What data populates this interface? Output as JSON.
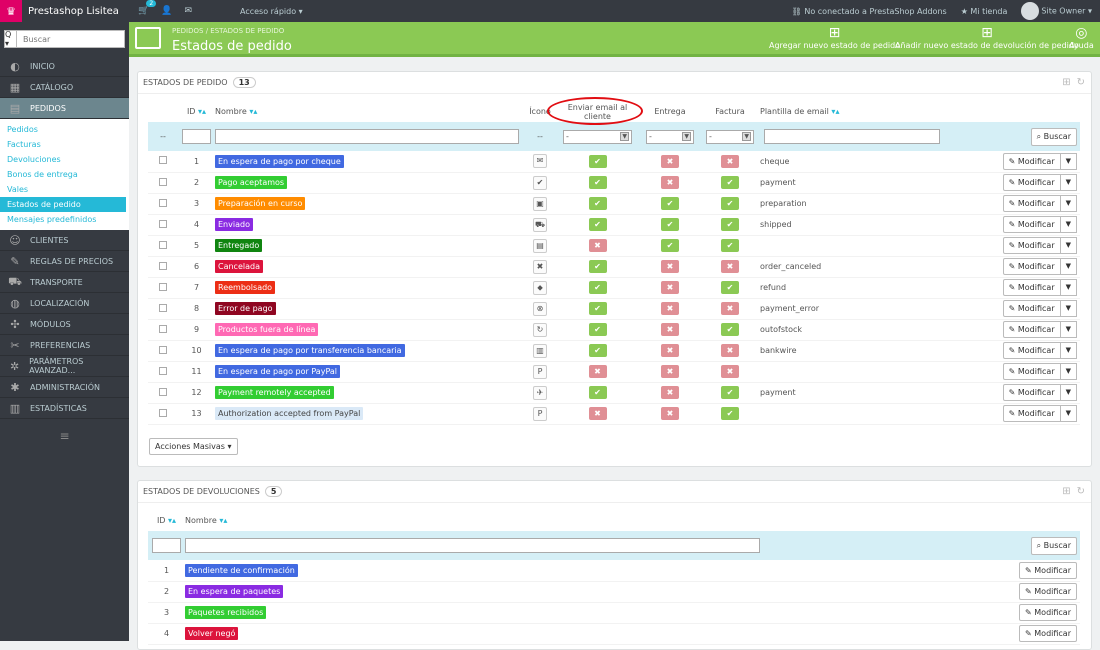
{
  "topbar": {
    "brand": "Prestashop Lisitea",
    "cart_badge": "2",
    "quick_access": "Acceso rápido ▾",
    "addons": "No conectado a PrestaShop Addons",
    "store": "Mi tienda",
    "user": "Site Owner ▾"
  },
  "sidebar": {
    "search_btn": "Q ▾",
    "search_placeholder": "Buscar",
    "top_items": [
      {
        "label": "INICIO",
        "icon": "dashboard-icon"
      },
      {
        "label": "CATÁLOGO",
        "icon": "catalog-icon"
      },
      {
        "label": "PEDIDOS",
        "icon": "orders-icon"
      }
    ],
    "sub_items": [
      "Pedidos",
      "Facturas",
      "Devoluciones",
      "Bonos de entrega",
      "Vales",
      "Estados de pedido",
      "Mensajes predefinidos"
    ],
    "bottom_items": [
      {
        "label": "CLIENTES",
        "icon": "customers-icon"
      },
      {
        "label": "REGLAS DE PRECIOS",
        "icon": "price-rules-icon"
      },
      {
        "label": "TRANSPORTE",
        "icon": "truck-icon"
      },
      {
        "label": "LOCALIZACIÓN",
        "icon": "globe-icon"
      },
      {
        "label": "MÓDULOS",
        "icon": "puzzle-icon"
      },
      {
        "label": "PREFERENCIAS",
        "icon": "wrench-icon"
      },
      {
        "label": "PARÁMETROS AVANZAD...",
        "icon": "gears-icon"
      },
      {
        "label": "ADMINISTRACIÓN",
        "icon": "cog-icon"
      },
      {
        "label": "ESTADÍSTICAS",
        "icon": "stats-icon"
      }
    ],
    "hamburger": "≡"
  },
  "header": {
    "bc1": "PEDIDOS",
    "bc_sep": "/",
    "bc2": "ESTADOS DE PEDIDO",
    "title": "Estados de pedido",
    "btn_add": "Agregar nuevo estado de pedido",
    "btn_add_return": "Añadir nuevo estado de devolución de pedido",
    "btn_help": "Ayuda"
  },
  "orders_panel": {
    "title": "ESTADOS DE PEDIDO",
    "count": "13",
    "cols": {
      "id": "ID",
      "name": "Nombre",
      "icon": "Ícono",
      "email": "Enviar email al cliente",
      "delivery": "Entrega",
      "invoice": "Factura",
      "template": "Plantilla de email"
    },
    "filter_dash": "--",
    "select_default": "-",
    "search_btn": "Buscar",
    "modify": "Modificar",
    "bulk": "Acciones Masivas ▾",
    "rows": [
      {
        "id": "1",
        "name": "En espera de pago por cheque",
        "color": "#4169e1",
        "icon": "cheque-icon",
        "email": true,
        "delivery": false,
        "invoice": false,
        "template": "cheque"
      },
      {
        "id": "2",
        "name": "Pago aceptamos",
        "color": "#32cd32",
        "icon": "checkmark-icon",
        "email": true,
        "delivery": false,
        "invoice": true,
        "template": "payment"
      },
      {
        "id": "3",
        "name": "Preparación en curso",
        "color": "#ff8c00",
        "icon": "package-icon",
        "email": true,
        "delivery": true,
        "invoice": true,
        "template": "preparation"
      },
      {
        "id": "4",
        "name": "Enviado",
        "color": "#8a2be2",
        "icon": "truck-icon",
        "email": true,
        "delivery": true,
        "invoice": true,
        "template": "shipped"
      },
      {
        "id": "5",
        "name": "Entregado",
        "color": "#108510",
        "icon": "delivered-icon",
        "email": false,
        "delivery": true,
        "invoice": true,
        "template": ""
      },
      {
        "id": "6",
        "name": "Cancelada",
        "color": "#dc143c",
        "icon": "cross-icon",
        "email": true,
        "delivery": false,
        "invoice": false,
        "template": "order_canceled"
      },
      {
        "id": "7",
        "name": "Reembolsado",
        "color": "#ec2e15",
        "icon": "refund-icon",
        "email": true,
        "delivery": false,
        "invoice": true,
        "template": "refund"
      },
      {
        "id": "8",
        "name": "Error de pago",
        "color": "#8f0621",
        "icon": "error-icon",
        "email": true,
        "delivery": false,
        "invoice": false,
        "template": "payment_error"
      },
      {
        "id": "9",
        "name": "Productos fuera de línea",
        "color": "#ff69b4",
        "icon": "outofstock-icon",
        "email": true,
        "delivery": false,
        "invoice": true,
        "template": "outofstock"
      },
      {
        "id": "10",
        "name": "En espera de pago por transferencia bancaria",
        "color": "#4169e1",
        "icon": "bankwire-icon",
        "email": true,
        "delivery": false,
        "invoice": false,
        "template": "bankwire"
      },
      {
        "id": "11",
        "name": "En espera de pago por PayPal",
        "color": "#4169e1",
        "icon": "paypal-icon",
        "email": false,
        "delivery": false,
        "invoice": false,
        "template": ""
      },
      {
        "id": "12",
        "name": "Payment remotely accepted",
        "color": "#32cd32",
        "icon": "remote-payment-icon",
        "email": true,
        "delivery": false,
        "invoice": true,
        "template": "payment"
      },
      {
        "id": "13",
        "name": "Authorization accepted from PayPal",
        "color": "#dae9f7",
        "icon": "paypal-icon",
        "email": false,
        "delivery": false,
        "invoice": true,
        "template": ""
      }
    ]
  },
  "returns_panel": {
    "title": "ESTADOS DE DEVOLUCIONES",
    "count": "5",
    "cols": {
      "id": "ID",
      "name": "Nombre"
    },
    "search_btn": "Buscar",
    "modify": "Modificar",
    "rows": [
      {
        "id": "1",
        "name": "Pendiente de confirmación",
        "color": "#4169e1"
      },
      {
        "id": "2",
        "name": "En espera de paquetes",
        "color": "#8a2be2"
      },
      {
        "id": "3",
        "name": "Paquetes recibidos",
        "color": "#32cd32"
      },
      {
        "id": "4",
        "name": "Volver negó",
        "color": "#dc143c"
      }
    ]
  }
}
